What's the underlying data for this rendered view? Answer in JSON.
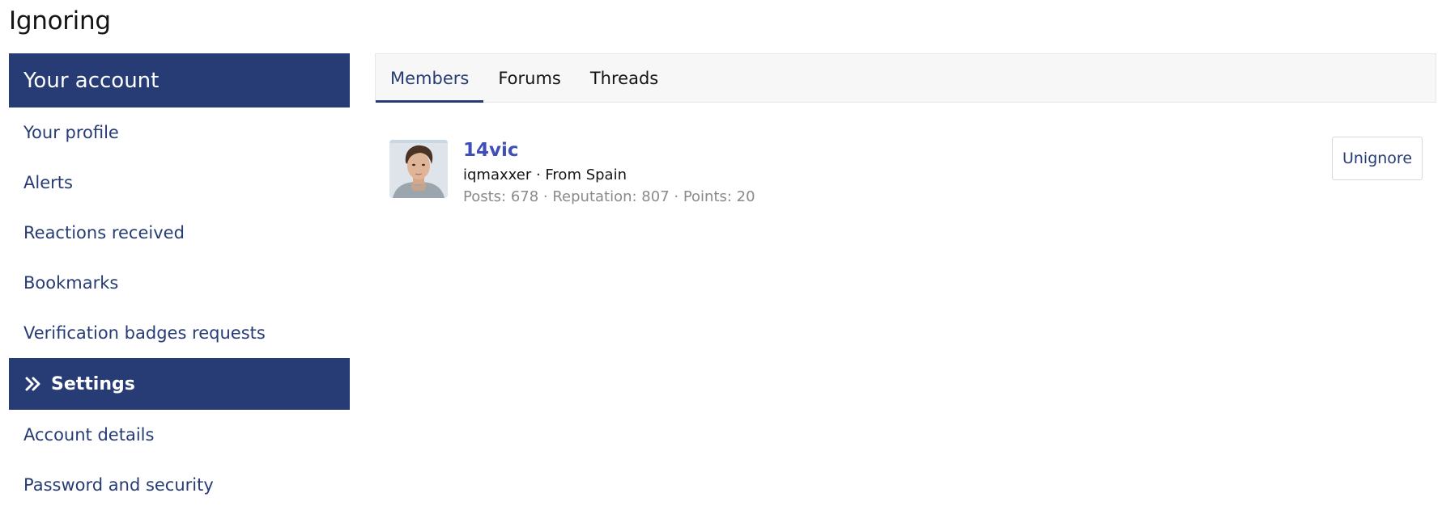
{
  "page": {
    "title": "Ignoring"
  },
  "sidebar": {
    "header": "Your account",
    "items": [
      {
        "label": "Your profile"
      },
      {
        "label": "Alerts"
      },
      {
        "label": "Reactions received"
      },
      {
        "label": "Bookmarks"
      },
      {
        "label": "Verification badges requests"
      }
    ],
    "section": {
      "label": "Settings",
      "icon": "double-chevron-right-icon"
    },
    "settings_items": [
      {
        "label": "Account details"
      },
      {
        "label": "Password and security"
      }
    ]
  },
  "tabs": [
    {
      "label": "Members",
      "active": true
    },
    {
      "label": "Forums",
      "active": false
    },
    {
      "label": "Threads",
      "active": false
    }
  ],
  "members": [
    {
      "name": "14vic",
      "title": "iqmaxxer",
      "separator": "·",
      "location": "From Spain",
      "sub": "iqmaxxer · From Spain",
      "stats": "Posts: 678 · Reputation: 807 · Points: 20",
      "action_label": "Unignore"
    }
  ],
  "colors": {
    "primary": "#273c75",
    "link": "#3f4fb8",
    "muted": "#8a8a8a"
  }
}
